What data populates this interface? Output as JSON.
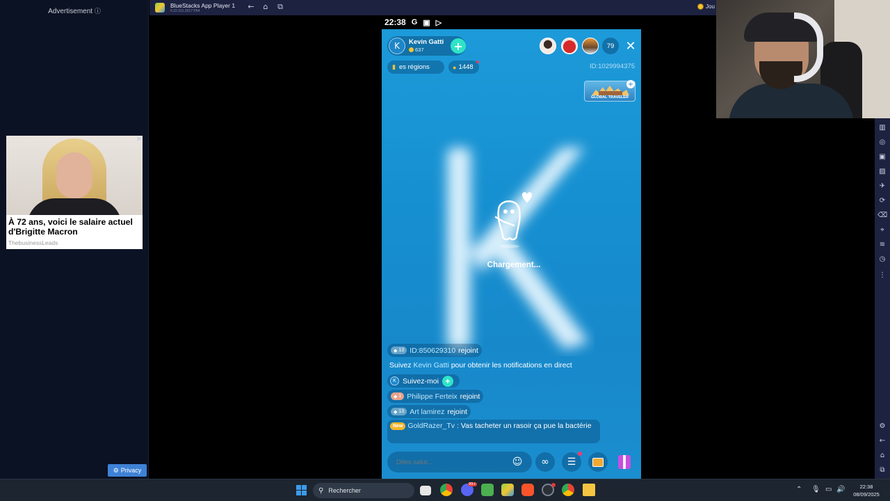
{
  "ad": {
    "label": "Advertisement",
    "title": "À 72 ans, voici le salaire actuel d'Brigitte Macron",
    "source": "ThebusinessLeads",
    "privacy_label": "Privacy"
  },
  "bluestacks": {
    "title": "BlueStacks App Player 1",
    "version": "5.22.101.2017  P64",
    "join_label": "Jou"
  },
  "status_bar": {
    "time": "22:38"
  },
  "live": {
    "host_initial": "K",
    "host_name": "Kevin Gatti",
    "host_coins": "637",
    "viewer_count": "79",
    "regions_label": "es régions",
    "likes": "1448",
    "room_id": "ID:1029994375",
    "traveler_label": "GLOBAL TRAVELER",
    "loading": "Chargement..."
  },
  "chat": {
    "join1": {
      "level": "13",
      "user": "ID:850629310",
      "action": "rejoint"
    },
    "follow_prefix": "Suivez",
    "follow_user": "Kevin Gatti",
    "follow_suffix": "pour obtenir les notifications en direct",
    "suivez_initial": "K",
    "suivez_label": "Suivez-moi",
    "join2": {
      "level": "1",
      "user": "Philippe Ferteix",
      "action": "rejoint"
    },
    "join3": {
      "level": "13",
      "user": "Art lamirez",
      "action": "rejoint"
    },
    "message": {
      "badge": "New",
      "user": "GoldRazer_Tv",
      "text": ": Vas tacheter un rasoir ça pue la bactérie"
    }
  },
  "input": {
    "placeholder": "Dites salut..."
  },
  "taskbar": {
    "search_label": "Rechercher",
    "time": "22:38",
    "date": "08/09/2025",
    "discord_badge": "99+"
  },
  "colors": {
    "phone_bg": "#1b8ecf",
    "accent_teal": "#2fe3c7",
    "chat_name": "#bde8ff"
  }
}
